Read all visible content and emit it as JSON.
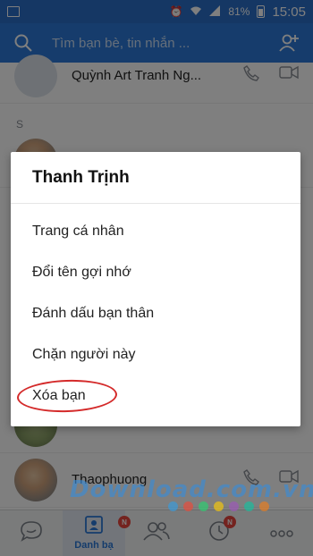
{
  "status_bar": {
    "battery": "81%",
    "time": "15:05"
  },
  "search": {
    "placeholder": "Tìm bạn bè, tin nhắn ..."
  },
  "contacts": [
    {
      "name": "Quỳnh Art Tranh Ng..."
    },
    {
      "name": ""
    },
    {
      "name": "Thaophuong"
    }
  ],
  "section_letter": "S",
  "dialog": {
    "title": "Thanh Trịnh",
    "items": [
      {
        "label": "Trang cá nhân"
      },
      {
        "label": "Đổi tên gợi nhớ"
      },
      {
        "label": "Đánh dấu bạn thân"
      },
      {
        "label": "Chặn người này"
      },
      {
        "label": "Xóa bạn"
      }
    ]
  },
  "bottom_nav": {
    "contacts_label": "Danh bạ",
    "badge_text": "N"
  },
  "watermark": {
    "text": "Download.com.vn",
    "dot_colors": [
      "#3a9ad9",
      "#e74c3c",
      "#2ecc71",
      "#f1c40f",
      "#9b59b6",
      "#1abc9c",
      "#e67e22"
    ]
  },
  "colors": {
    "header": "#2c79d8",
    "accent": "#2c79d8",
    "highlight_ring": "#d42a2a",
    "badge": "#e8473e"
  }
}
